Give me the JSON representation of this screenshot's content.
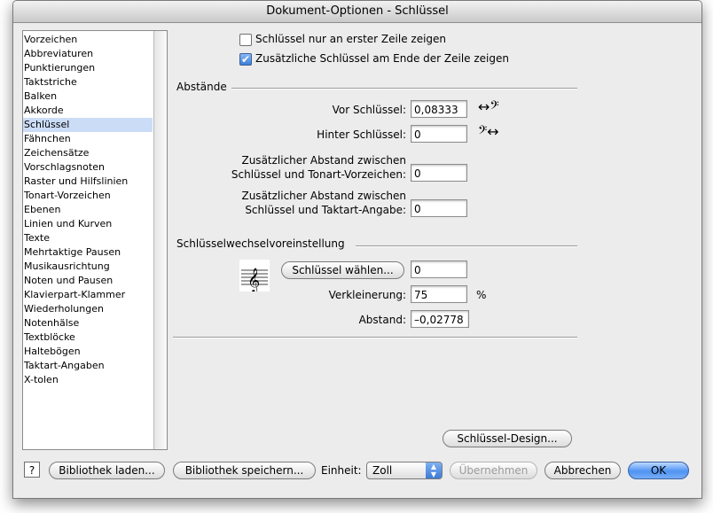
{
  "window": {
    "title": "Dokument-Optionen - Schlüssel"
  },
  "sidebar": {
    "items": [
      "Vorzeichen",
      "Abbreviaturen",
      "Punktierungen",
      "Taktstriche",
      "Balken",
      "Akkorde",
      "Schlüssel",
      "Fähnchen",
      "Zeichensätze",
      "Vorschlagsnoten",
      "Raster und Hilfslinien",
      "Tonart-Vorzeichen",
      "Ebenen",
      "Linien und Kurven",
      "Texte",
      "Mehrtaktige Pausen",
      "Musikausrichtung",
      "Noten und Pausen",
      "Klavierpart-Klammer",
      "Wiederholungen",
      "Notenhälse",
      "Textblöcke",
      "Haltebögen",
      "Taktart-Angaben",
      "X-tolen"
    ],
    "selected_index": 6
  },
  "options": {
    "first_line_only": {
      "label": "Schlüssel nur an erster Zeile zeigen",
      "checked": false
    },
    "end_of_line": {
      "label": "Zusätzliche Schlüssel am Ende der Zeile zeigen",
      "checked": true
    }
  },
  "abstaende": {
    "heading": "Abstände",
    "before_clef_label": "Vor Schlüssel:",
    "before_clef_value": "0,08333",
    "after_clef_label": "Hinter Schlüssel:",
    "after_clef_value": "0",
    "key_sig_label_1": "Zusätzlicher Abstand zwischen",
    "key_sig_label_2": "Schlüssel und Tonart-Vorzeichen:",
    "key_sig_value": "0",
    "time_sig_label_1": "Zusätzlicher Abstand zwischen",
    "time_sig_label_2": "Schlüssel und Taktart-Angabe:",
    "time_sig_value": "0"
  },
  "clef_change": {
    "heading": "Schlüsselwechselvoreinstellung",
    "choose_button": "Schlüssel wählen...",
    "clef_value": "0",
    "reduction_label": "Verkleinerung:",
    "reduction_value": "75",
    "reduction_unit": "%",
    "distance_label": "Abstand:",
    "distance_value": "–0,02778"
  },
  "buttons": {
    "clef_design": "Schlüssel-Design...",
    "help": "?",
    "load_library": "Bibliothek laden...",
    "save_library": "Bibliothek speichern...",
    "unit_label": "Einheit:",
    "unit_value": "Zoll",
    "apply": "Übernehmen",
    "cancel": "Abbrechen",
    "ok": "OK"
  },
  "icons": {
    "before_clef": "arrow-bass-clef-icon",
    "after_clef": "bass-clef-arrow-icon",
    "clef_preview": "treble-clef-staff-icon"
  }
}
